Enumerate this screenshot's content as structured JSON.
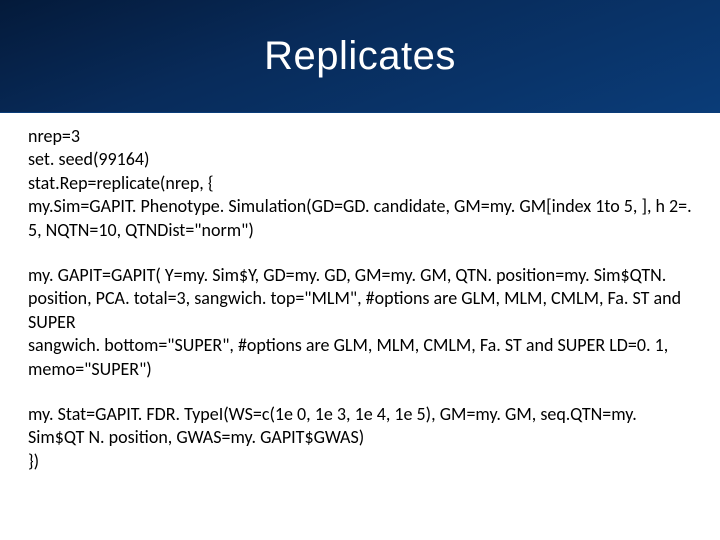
{
  "slide": {
    "title": "Replicates",
    "block1": {
      "line1": "nrep=3",
      "line2": "set. seed(99164)",
      "line3": "stat.Rep=replicate(nrep, {",
      "line4": "my.Sim=GAPIT. Phenotype. Simulation(GD=GD. candidate, GM=my. GM[index 1to 5, ], h 2=. 5, NQTN=10, QTNDist=\"norm\")"
    },
    "block2": {
      "line1": "my. GAPIT=GAPIT(  Y=my. Sim$Y,  GD=my. GD,  GM=my. GM,  QTN. position=my. Sim$QTN. position,  PCA. total=3,  sangwich. top=\"MLM\",  #options are GLM, MLM, CMLM, Fa. ST and SUPER",
      "line2": "sangwich. bottom=\"SUPER\",  #options are GLM, MLM, CMLM, Fa. ST and SUPER  LD=0. 1,  memo=\"SUPER\")"
    },
    "block3": {
      "line1": "my. Stat=GAPIT. FDR. TypeI(WS=c(1e 0, 1e 3, 1e 4, 1e 5), GM=my. GM, seq.QTN=my. Sim$QT N. position, GWAS=my. GAPIT$GWAS)",
      "line2": "})"
    }
  }
}
